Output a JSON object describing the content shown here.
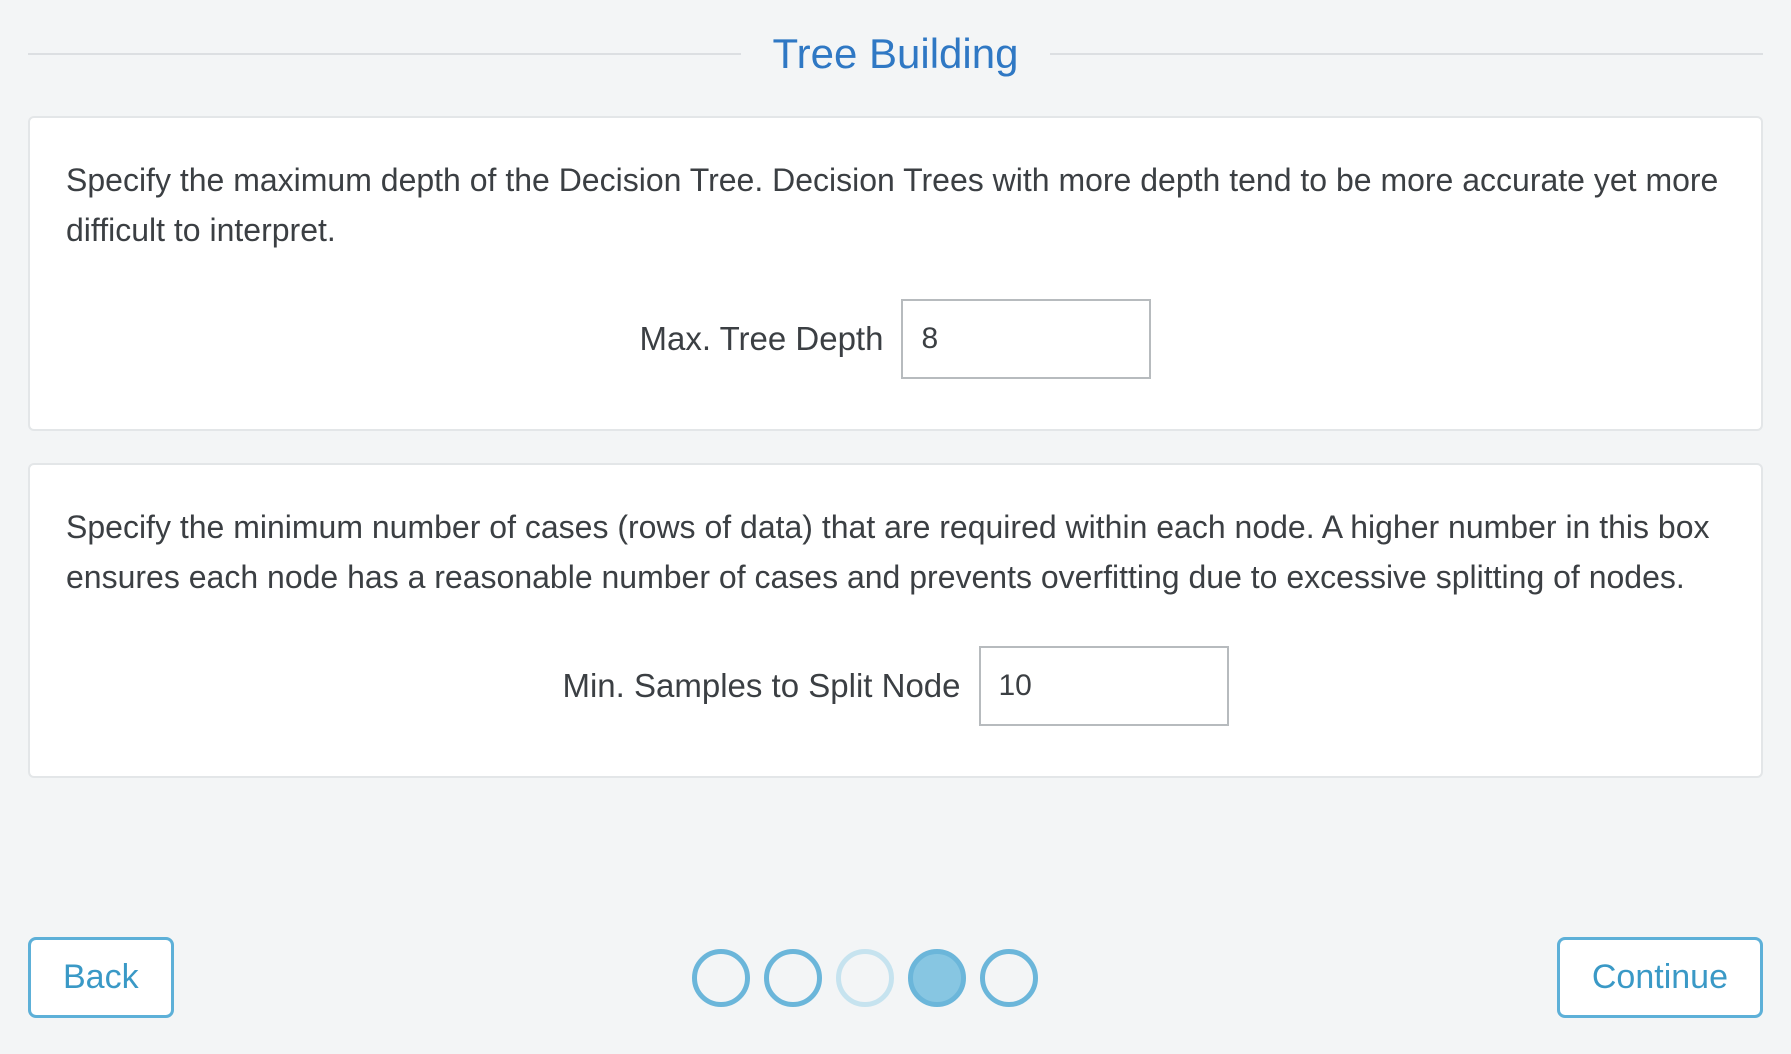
{
  "header": {
    "title": "Tree Building"
  },
  "cards": {
    "max_depth": {
      "description": "Specify the maximum depth of the Decision Tree. Decision Trees with more depth tend to be more accurate yet more difficult to interpret.",
      "label": "Max. Tree Depth",
      "value": "8"
    },
    "min_samples": {
      "description": "Specify the minimum number of cases (rows of data) that are required within each node. A higher number in this box ensures each node has a reasonable number of cases and prevents overfitting due to excessive splitting of nodes.",
      "label": "Min. Samples to Split Node",
      "value": "10"
    }
  },
  "nav": {
    "back_label": "Back",
    "continue_label": "Continue",
    "steps_total": 5,
    "current_step_index": 3
  }
}
